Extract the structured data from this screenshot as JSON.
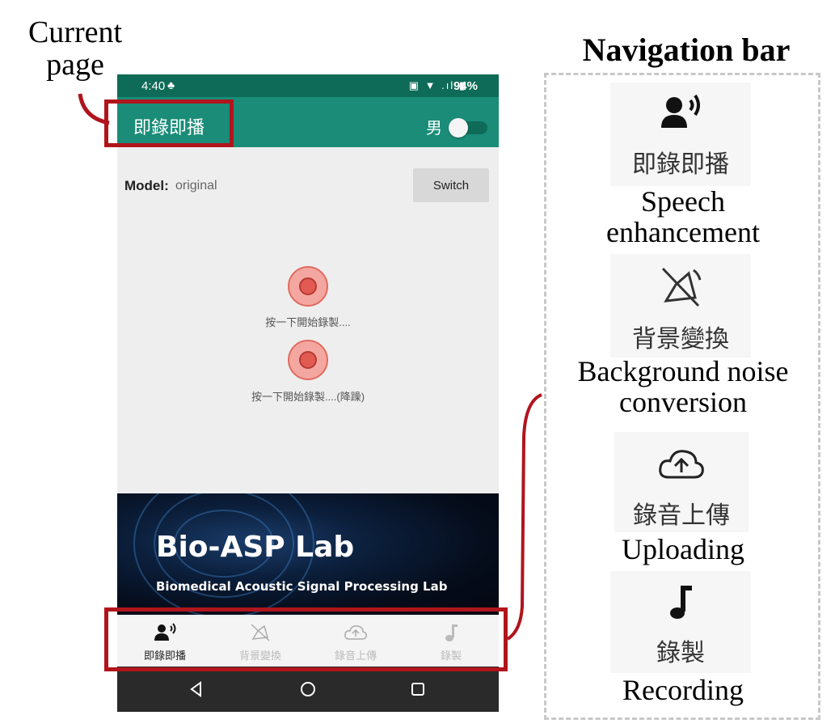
{
  "annotations": {
    "current_page_line1": "Current",
    "current_page_line2": "page",
    "nav_bar_title": "Navigation bar"
  },
  "status_bar": {
    "time": "4:40",
    "battery": "94%"
  },
  "app_bar": {
    "title": "即錄即播",
    "gender_label": "男"
  },
  "model": {
    "label": "Model:",
    "value": "original",
    "switch_label": "Switch"
  },
  "recorders": [
    {
      "label": "按一下開始錄製...."
    },
    {
      "label": "按一下開始錄製....(降躁)"
    }
  ],
  "banner": {
    "title": "Bio-ASP Lab",
    "subtitle": "Biomedical Acoustic Signal Processing Lab"
  },
  "bottom_nav": [
    {
      "label": "即錄即播",
      "icon": "speaking-person-icon",
      "active": true
    },
    {
      "label": "背景變換",
      "icon": "speaker-off-icon",
      "active": false
    },
    {
      "label": "錄音上傳",
      "icon": "cloud-upload-icon",
      "active": false
    },
    {
      "label": "錄製",
      "icon": "music-note-icon",
      "active": false
    }
  ],
  "nav_legend": [
    {
      "label": "即錄即播",
      "english_line1": "Speech",
      "english_line2": "enhancement"
    },
    {
      "label": "背景變換",
      "english_line1": "Background noise",
      "english_line2": "conversion"
    },
    {
      "label": "錄音上傳",
      "english_line1": "Uploading",
      "english_line2": ""
    },
    {
      "label": "錄製",
      "english_line1": "Recording",
      "english_line2": ""
    }
  ],
  "colors": {
    "app_bar": "#1a8c78",
    "status_bar": "#0e6b57",
    "highlight": "#b0151c"
  }
}
